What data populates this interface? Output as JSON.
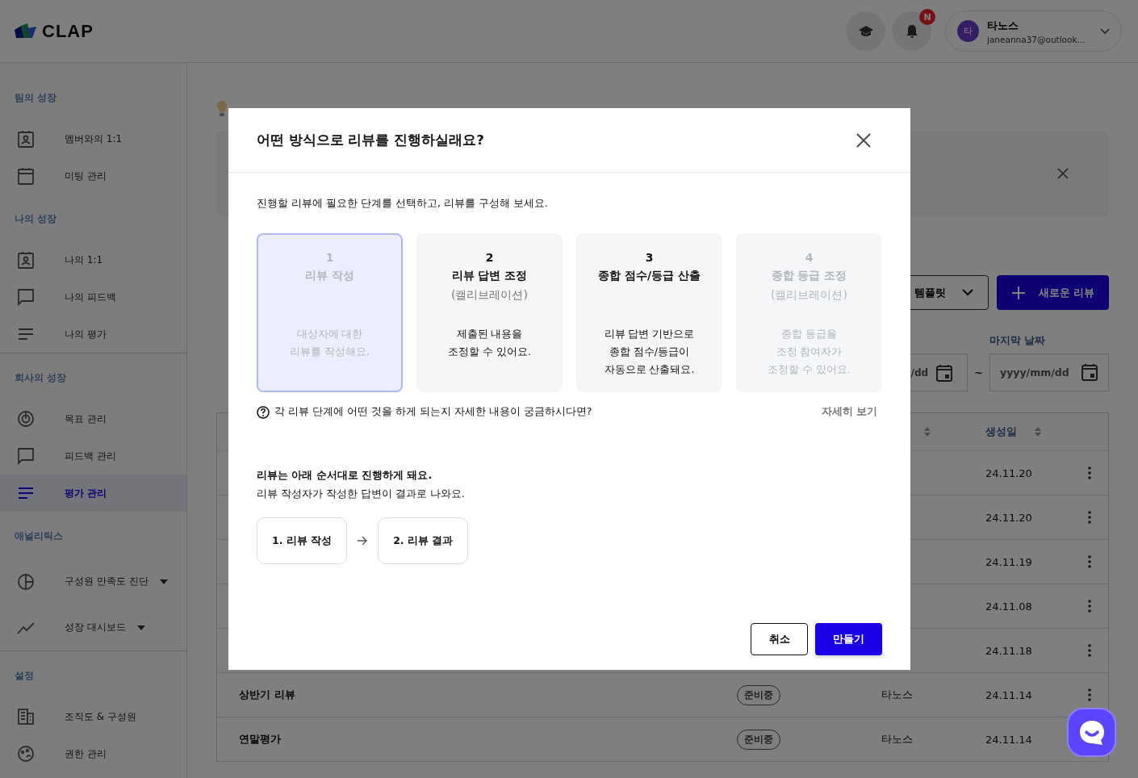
{
  "header": {
    "logo": "CLAP",
    "notification_badge": "N",
    "user": {
      "avatar": "타",
      "name": "타노스",
      "email": "janeanna37@outlook..."
    }
  },
  "sidebar": {
    "sections": [
      {
        "title": "팀의 성장",
        "divided": false,
        "items": [
          {
            "label": "멤버와의 1:1",
            "selected": false
          },
          {
            "label": "미팅 관리",
            "selected": false
          }
        ]
      },
      {
        "title": "나의 성장",
        "divided": false,
        "items": [
          {
            "label": "나의 1:1",
            "selected": false
          },
          {
            "label": "나의 피드백",
            "selected": false
          },
          {
            "label": "나의 평가",
            "selected": false
          }
        ]
      },
      {
        "title": "회사의 성장",
        "divided": true,
        "items": [
          {
            "label": "목표 관리",
            "selected": false
          },
          {
            "label": "피드백 관리",
            "selected": false
          },
          {
            "label": "평가 관리",
            "selected": true
          }
        ]
      },
      {
        "title": "애널리틱스",
        "divided": false,
        "items": [
          {
            "label": "구성원 만족도 진단",
            "selected": false,
            "expanded": false
          },
          {
            "label": "성장 대시보드",
            "selected": false,
            "expanded": false
          }
        ]
      },
      {
        "title": "설정",
        "divided": true,
        "items": [
          {
            "label": "조직도 & 구성원",
            "selected": false
          },
          {
            "label": "권한 관리",
            "selected": false
          }
        ]
      }
    ]
  },
  "main": {
    "template_button": "템플릿",
    "new_button": "새로운 리뷰",
    "filter_label": "마지막 날짜",
    "start_date": "/dd",
    "date_separator": "~",
    "end_date_placeholder": "yyyy/mm/dd",
    "table": {
      "date_column": "생성일",
      "rows": [
        {
          "date": "24.11.20"
        },
        {
          "date": "24.11.20"
        },
        {
          "date": "24.11.19"
        },
        {
          "date": "24.11.08"
        },
        {
          "date": "24.11.18"
        },
        {
          "name": "상반기 리뷰",
          "status": "준비중",
          "owner": "타노스",
          "date": "24.11.14"
        },
        {
          "name": "연말평가",
          "status": "준비중",
          "owner": "타노스",
          "date": "24.11.14"
        }
      ]
    }
  },
  "modal": {
    "title": "어떤 방식으로 리뷰를 진행하실래요?",
    "intro": "진행할 리뷰에 필요한 단계를 선택하고, 리뷰를 구성해 보세요.",
    "steps": [
      {
        "number": "1",
        "title": "리뷰 작성",
        "description": [
          "대상자에 대한",
          "리뷰를 작성해요."
        ],
        "selected": true,
        "disabled": true
      },
      {
        "number": "2",
        "title": "리뷰 답변 조정",
        "subtitle": "(캘리브레이션)",
        "description": [
          "제출된 내용을",
          "조정할 수 있어요."
        ],
        "selected": false,
        "disabled": false
      },
      {
        "number": "3",
        "title": "종합 점수/등급 산출",
        "description": [
          "리뷰 답변 기반으로",
          "종합 점수/등급이",
          "자동으로 산출돼요."
        ],
        "selected": false,
        "disabled": false
      },
      {
        "number": "4",
        "title": "종합 등급 조정",
        "subtitle": "(캘리브레이션)",
        "description": [
          "종합 등급을",
          "조정 참여자가",
          "조정할 수 있어요."
        ],
        "selected": false,
        "disabled": true
      }
    ],
    "help_text": "각 리뷰 단계에 어떤 것을 하게 되는지 자세한 내용이 궁금하시다면?",
    "help_link": "자세히 보기",
    "order_title": "리뷰는 아래 순서대로 진행하게 돼요.",
    "order_text": "리뷰 작성자가 작성한 답변이 결과로 나와요.",
    "flow": [
      "1. 리뷰 작성",
      "2. 리뷰 결과"
    ],
    "cancel": "취소",
    "create": "만들기"
  }
}
